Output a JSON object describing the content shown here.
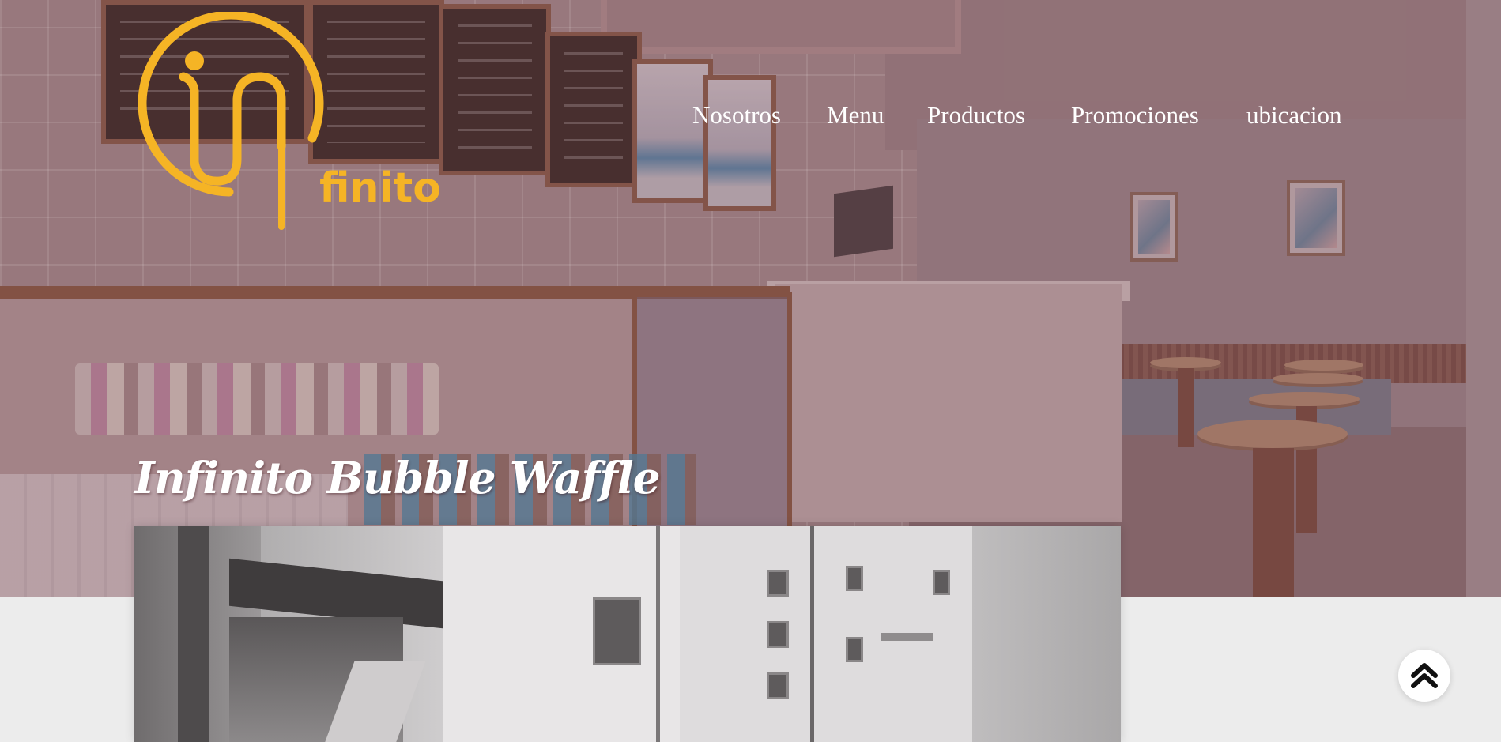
{
  "brand": {
    "logo_text": "finito",
    "logo_color": "#f5b425"
  },
  "nav": {
    "items": [
      {
        "label": "Nosotros"
      },
      {
        "label": "Menu"
      },
      {
        "label": "Productos"
      },
      {
        "label": "Promociones"
      },
      {
        "label": "ubicacion"
      }
    ]
  },
  "hero": {
    "title": "Infinito Bubble Waffle"
  },
  "feature_image": {
    "icon": "street-photo-image"
  },
  "back_to_top": {
    "icon": "double-chevron-up-icon"
  },
  "colors": {
    "nav_text": "#ffffff",
    "hero_title": "#ffffff",
    "page_background": "#ececec",
    "hero_tint": "#6e3e44"
  }
}
